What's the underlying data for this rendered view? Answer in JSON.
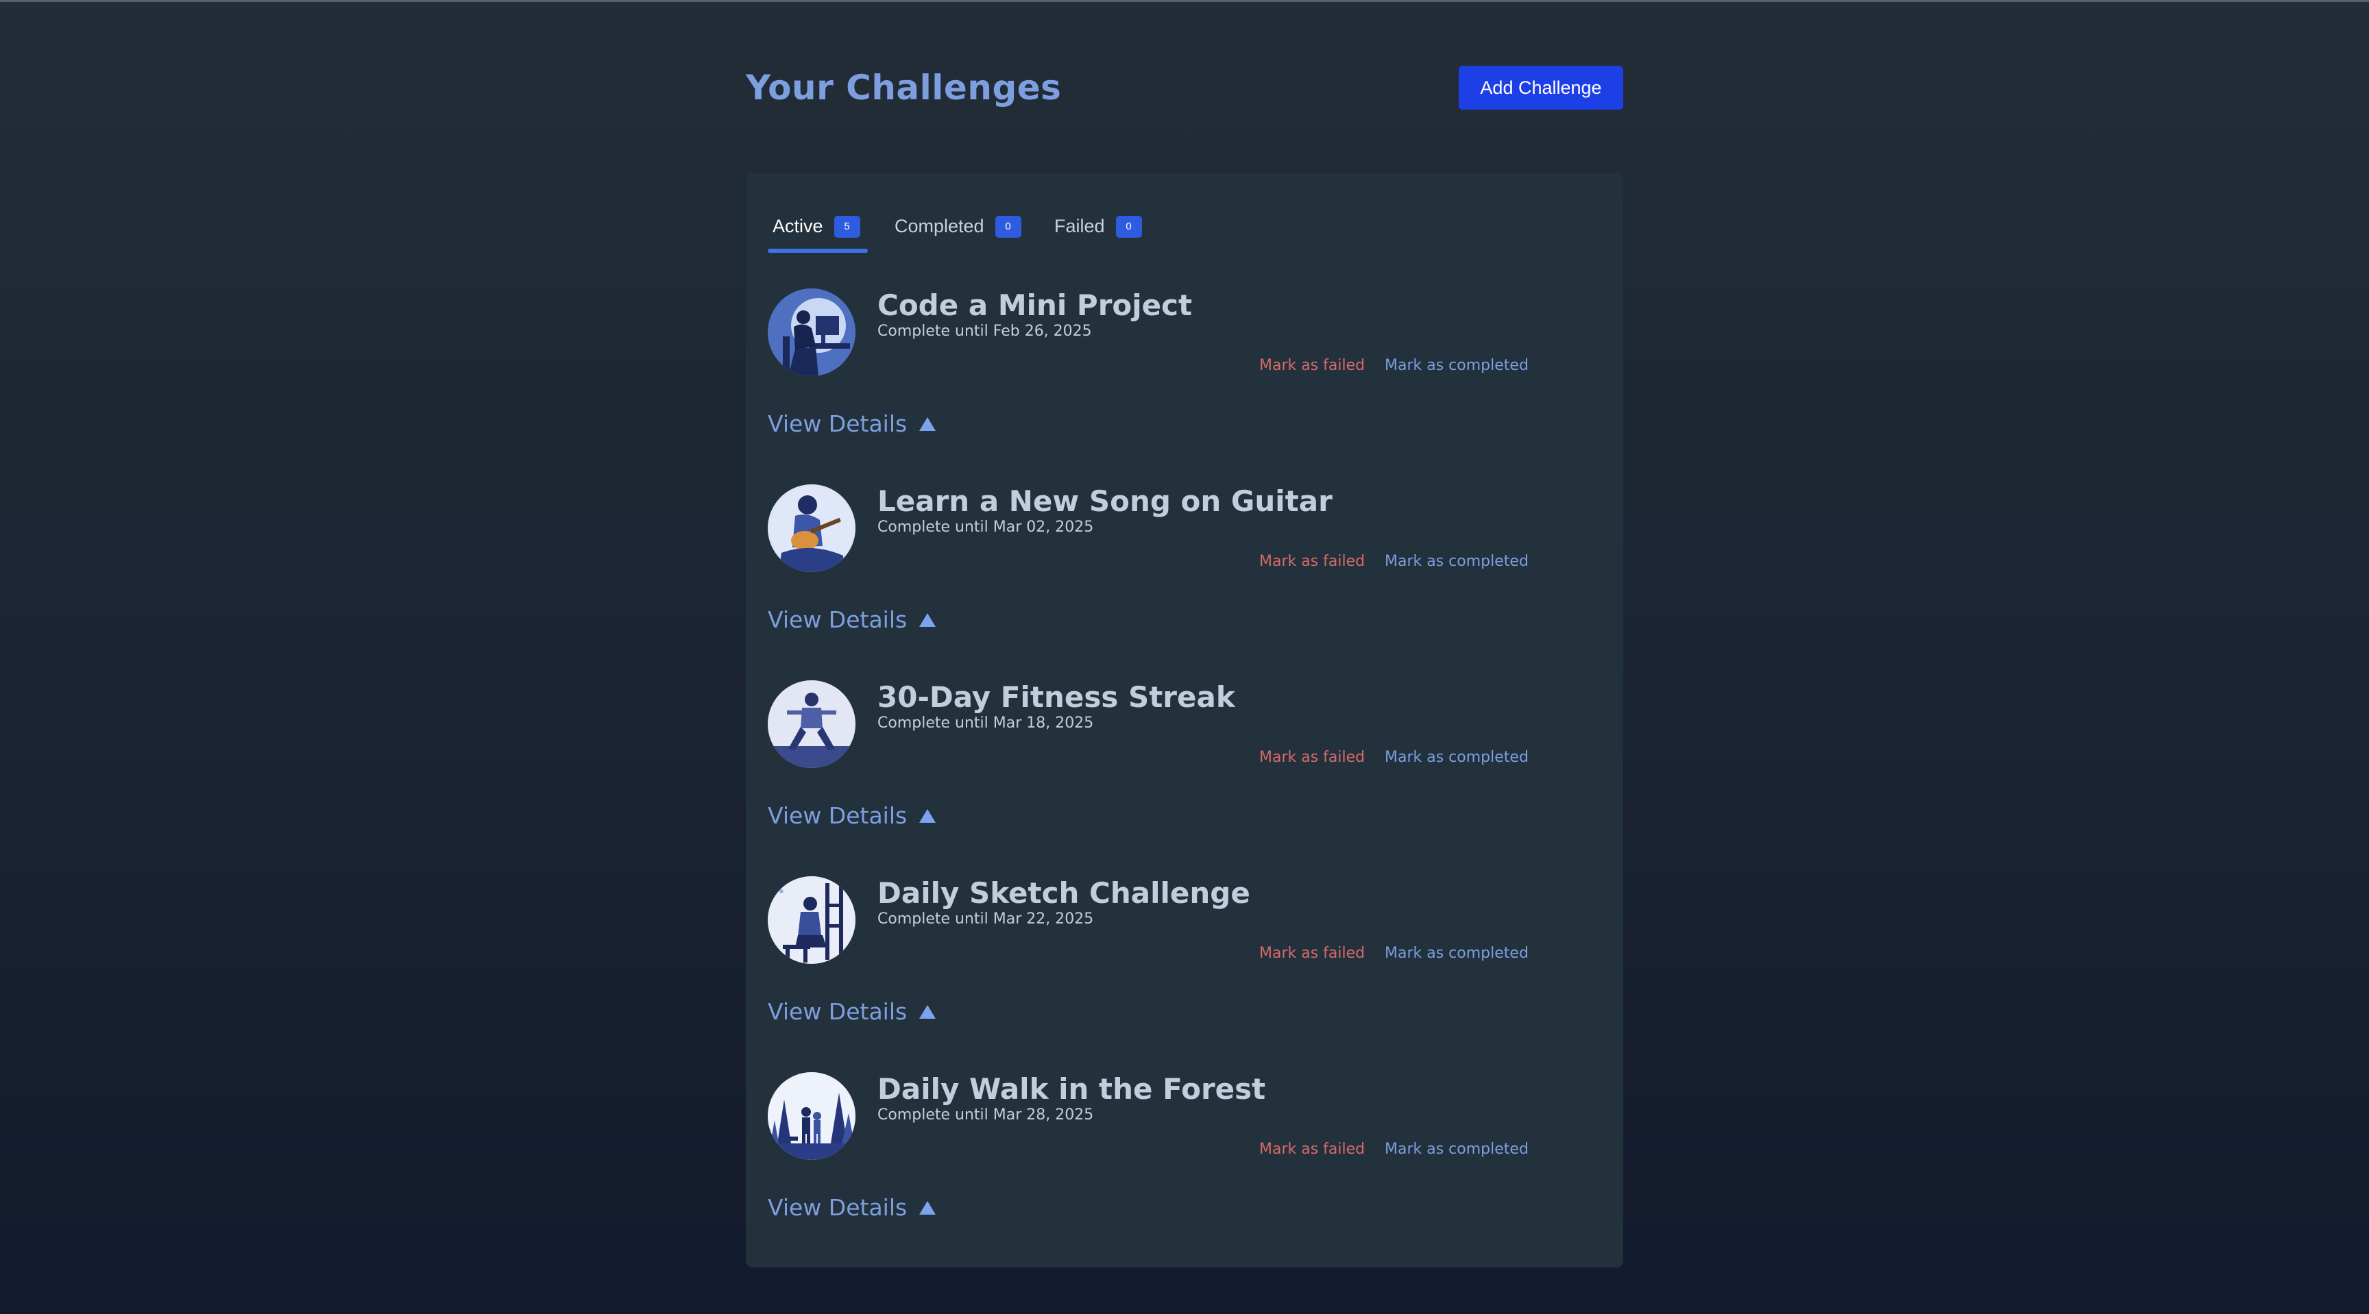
{
  "header": {
    "title": "Your Challenges",
    "add_button_label": "Add Challenge"
  },
  "tabs": [
    {
      "label": "Active",
      "count": "5"
    },
    {
      "label": "Completed",
      "count": "0"
    },
    {
      "label": "Failed",
      "count": "0"
    }
  ],
  "challenges": [
    {
      "title": "Code a Mini Project",
      "deadline": "Complete until Feb 26, 2025",
      "failed_label": "Mark as failed",
      "completed_label": "Mark as completed",
      "details_label": "View Details",
      "icon": "coder-icon"
    },
    {
      "title": "Learn a New Song on Guitar",
      "deadline": "Complete until Mar 02, 2025",
      "failed_label": "Mark as failed",
      "completed_label": "Mark as completed",
      "details_label": "View Details",
      "icon": "guitarist-icon"
    },
    {
      "title": "30-Day Fitness Streak",
      "deadline": "Complete until Mar 18, 2025",
      "failed_label": "Mark as failed",
      "completed_label": "Mark as completed",
      "details_label": "View Details",
      "icon": "fitness-icon"
    },
    {
      "title": "Daily Sketch Challenge",
      "deadline": "Complete until Mar 22, 2025",
      "failed_label": "Mark as failed",
      "completed_label": "Mark as completed",
      "details_label": "View Details",
      "icon": "sketch-icon"
    },
    {
      "title": "Daily Walk in the Forest",
      "deadline": "Complete until Mar 28, 2025",
      "failed_label": "Mark as failed",
      "completed_label": "Mark as completed",
      "details_label": "View Details",
      "icon": "forest-walk-icon"
    }
  ],
  "colors": {
    "accent": "#1d3fe6",
    "title": "#7d9fe0",
    "failed": "#d66a6a",
    "panel": "#23313c"
  }
}
